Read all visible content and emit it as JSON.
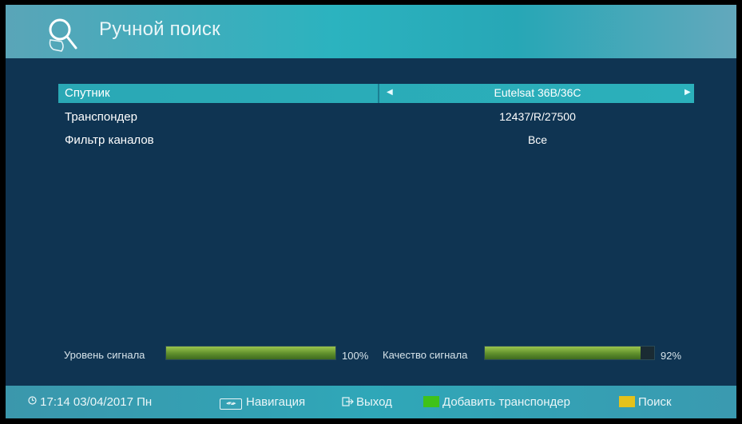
{
  "header": {
    "title": "Ручной поиск",
    "icon": "magnifier-hand-icon"
  },
  "menu": {
    "items": [
      {
        "label": "Спутник",
        "value": "Eutelsat 36B/36C",
        "selected": true,
        "has_arrows": true
      },
      {
        "label": "Транспондер",
        "value": "12437/R/27500",
        "selected": false,
        "has_arrows": false
      },
      {
        "label": "Фильтр каналов",
        "value": "Все",
        "selected": false,
        "has_arrows": false
      }
    ]
  },
  "signal": {
    "level_label": "Уровень сигнала",
    "level_value": 1.0,
    "level_text": "100%",
    "quality_label": "Качество сигнала",
    "quality_value": 0.92,
    "quality_text": "92%"
  },
  "footer": {
    "clock_icon": "clock-icon",
    "datetime": "17:14 03/04/2017 Пн",
    "nav_label": "Навигация",
    "exit_label": "Выход",
    "green_label": "Добавить транспондер",
    "yellow_label": "Поиск"
  },
  "colors": {
    "green_key": "#3fc21a",
    "yellow_key": "#e4c21b",
    "selected_row": "#2aa8b5",
    "background": "#0f3452"
  }
}
